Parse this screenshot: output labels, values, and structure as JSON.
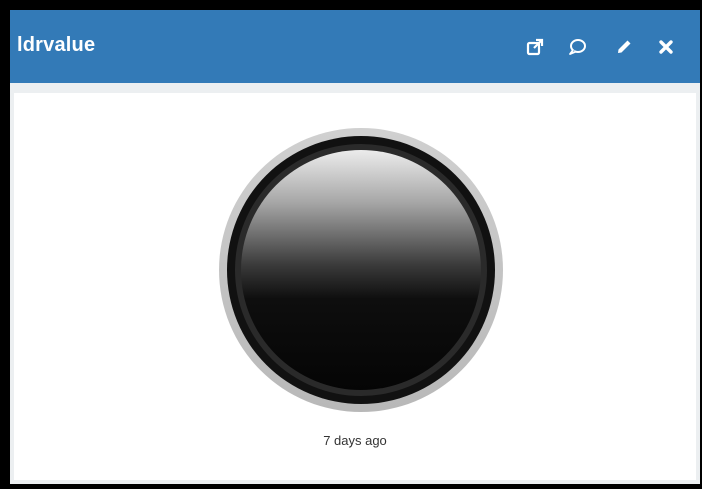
{
  "widget": {
    "title": "ldrvalue",
    "header_color": "#337ab7",
    "icons": [
      "external-link-icon",
      "comment-icon",
      "pencil-icon",
      "close-icon"
    ]
  },
  "indicator": {
    "state": "off",
    "timestamp": "7 days ago"
  }
}
